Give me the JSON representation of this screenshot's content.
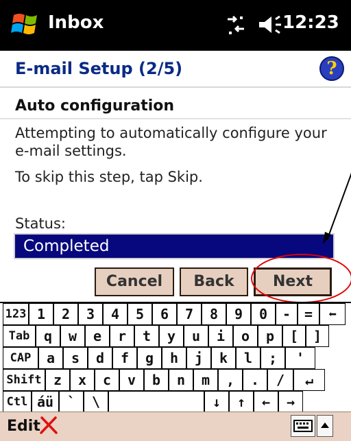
{
  "titlebar": {
    "app_title": "Inbox",
    "clock": "12:23",
    "icons": [
      "windows-start-icon",
      "connectivity-icon",
      "volume-icon"
    ]
  },
  "header": {
    "heading": "E-mail Setup (2/5)",
    "help_icon": "?"
  },
  "content": {
    "section_title": "Auto configuration",
    "intro_line1": "Attempting to automatically configure your",
    "intro_line2": "e-mail settings.",
    "skip_text": "To skip this step, tap Skip.",
    "status_label": "Status:",
    "status_value": "Completed"
  },
  "buttons": {
    "cancel": "Cancel",
    "back": "Back",
    "next": "Next"
  },
  "keyboard": {
    "rows": [
      [
        "123",
        "1",
        "2",
        "3",
        "4",
        "5",
        "6",
        "7",
        "8",
        "9",
        "0",
        "-",
        "=",
        "⬅"
      ],
      [
        "Tab",
        "q",
        "w",
        "e",
        "r",
        "t",
        "y",
        "u",
        "i",
        "o",
        "p",
        "[",
        "]"
      ],
      [
        "CAP",
        "a",
        "s",
        "d",
        "f",
        "g",
        "h",
        "j",
        "k",
        "l",
        ";",
        "'"
      ],
      [
        "Shift",
        "z",
        "x",
        "c",
        "v",
        "b",
        "n",
        "m",
        ",",
        ".",
        "/",
        "↵"
      ],
      [
        "Ctl",
        "áü",
        "`",
        "\\",
        "",
        "↓",
        "↑",
        "←",
        "→"
      ]
    ]
  },
  "bottombar": {
    "menu_edit": "Edit"
  },
  "colors": {
    "title_bg": "#000000",
    "heading": "#0a2a84",
    "status_bg": "#08087e",
    "button_bg": "#e7cfc0",
    "annotation": "#e30000"
  }
}
